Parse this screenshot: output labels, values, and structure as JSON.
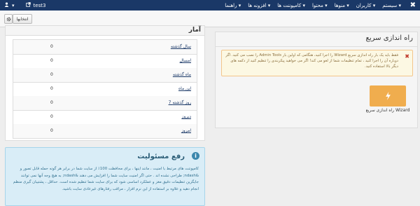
{
  "navbar": {
    "brand": "✖",
    "menu": [
      "سیستم ▾",
      "کاربران ▾",
      "منوها ▾",
      "محتوا ▾",
      "کامپوننت ها ▾",
      "افزونه ها ▾",
      "راهنما ▾"
    ],
    "site_name": "test3",
    "user_icon": "user-icon",
    "external_icon": "external-link-icon"
  },
  "toolbar": {
    "options_label": "انتخابها",
    "options_icon": "gear-icon"
  },
  "quick_setup": {
    "title": "راه اندازی سریع",
    "warning": "فقط باید یک بار راه اندازی سریع Wizard را اجرا کنید، هنگامی که اولین بار Admin Tools را نصب می کنید. اگر دوباره آن را اجرا کنید ، تمام تنظیمات شما از لغو می کند! اگر می خواهید پیکربندی را تنظیم کنید از دکمه های دیگر بالا استفاده کنید.",
    "warning_icon": "close-icon",
    "button_icon": "bolt-icon",
    "button_label": "راه اندازی سریع Wizard"
  },
  "stats": {
    "title": "آمار",
    "rows": [
      {
        "label": "سال گذشته",
        "value": "0"
      },
      {
        "label": "امسال",
        "value": "0"
      },
      {
        "label": "ماه گذشته",
        "value": "0"
      },
      {
        "label": "این ماه",
        "value": "0"
      },
      {
        "label": "7 روز گذشته",
        "value": "0"
      },
      {
        "label": "دیروز",
        "value": "0"
      },
      {
        "label": "امروز",
        "value": "0"
      }
    ]
  },
  "disclaimer": {
    "title": "رفع مسئولیت",
    "icon": "info-icon",
    "text": "کامپوننت های مرتبط با امنیت ، مانند اینها ، برای محافظت 100٪ از سایت شما در برابر هر گونه حمله قابل تصور و &ndash; طراحی نشده اند . حتی اگر امنیت سایت شما را افزایش می دهند &ndash; به هیچ وجه آنها نمی توانند جایگزین تنظیمات دقیق مغز و عملکرد اساسی شود که برای سایت شما تنظیم شده است. حداقل ، پشتیبان گیری منظم انجام دهید و علاوه بر استفاده از این نرم افزار ، مراقب رفتارهای غیرعادی سایت باشید."
  }
}
